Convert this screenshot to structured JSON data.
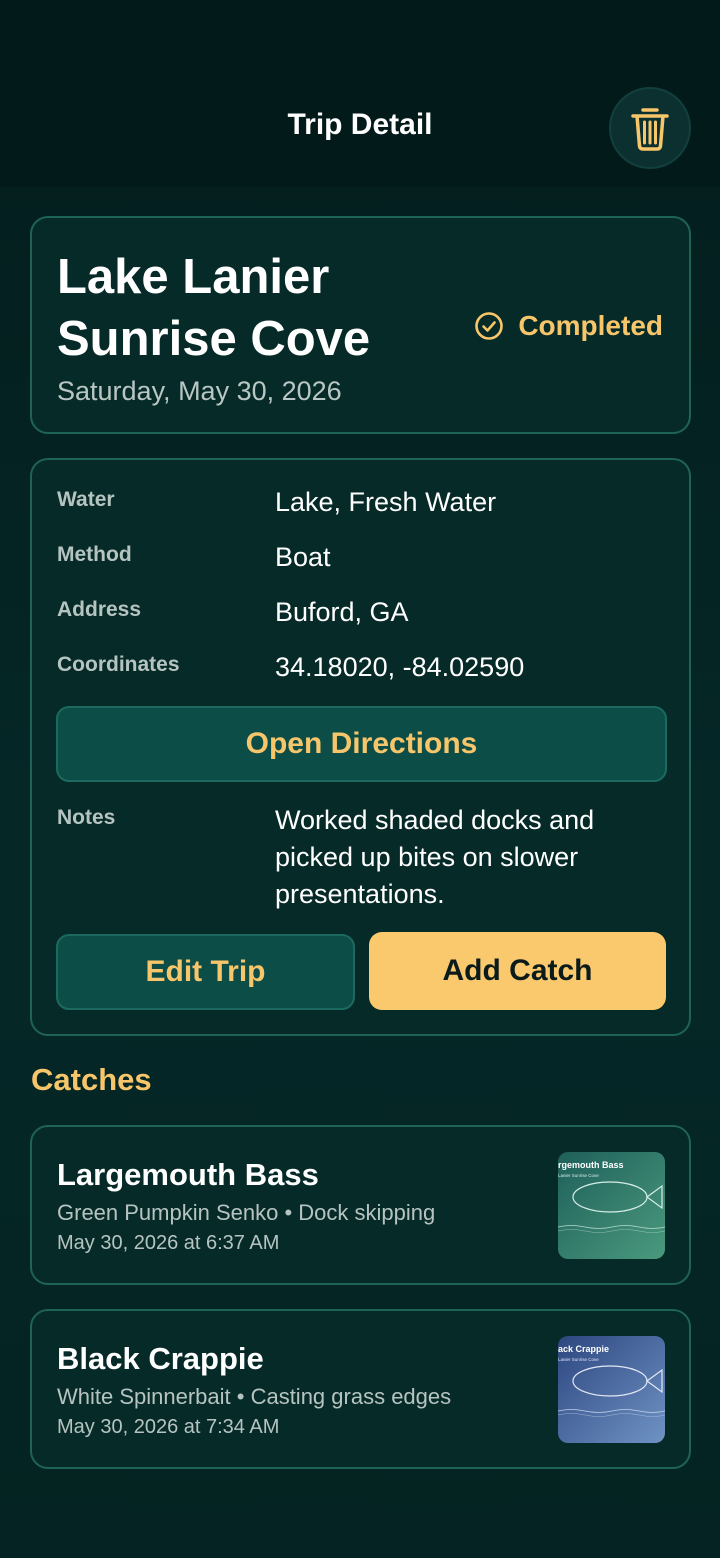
{
  "header": {
    "title": "Trip Detail",
    "trash_icon": "trash-icon"
  },
  "trip": {
    "name": "Lake Lanier Sunrise Cove",
    "date": "Saturday, May 30, 2026",
    "status": "Completed",
    "status_icon": "check-circle-icon"
  },
  "details": {
    "rows": [
      {
        "label": "Water",
        "value": "Lake, Fresh Water"
      },
      {
        "label": "Method",
        "value": "Boat"
      },
      {
        "label": "Address",
        "value": "Buford, GA"
      },
      {
        "label": "Coordinates",
        "value": "34.18020, -84.02590"
      }
    ],
    "directions_label": "Open Directions",
    "notes_label": "Notes",
    "notes_value": "Worked shaded docks and picked up bites on slower presentations.",
    "edit_label": "Edit Trip",
    "add_catch_label": "Add Catch"
  },
  "catches_title": "Catches",
  "catches": [
    {
      "species": "Largemouth Bass",
      "details": "Green Pumpkin Senko • Dock skipping",
      "time": "May 30, 2026 at 6:37 AM",
      "thumb_caption": "rgemouth Bass",
      "thumb_subcaption": "Lanier Sunrise Cove",
      "thumb_color": "#2f7a6c"
    },
    {
      "species": "Black Crappie",
      "details": "White Spinnerbait • Casting grass edges",
      "time": "May 30, 2026 at 7:34 AM",
      "thumb_caption": "ack Crappie",
      "thumb_subcaption": "Lanier Sunrise Cove",
      "thumb_color": "#4a6aa0"
    }
  ],
  "colors": {
    "accent": "#f7c66b",
    "background": "#04201f",
    "card_border": "#1f6358",
    "button_teal": "#0c4d48"
  }
}
